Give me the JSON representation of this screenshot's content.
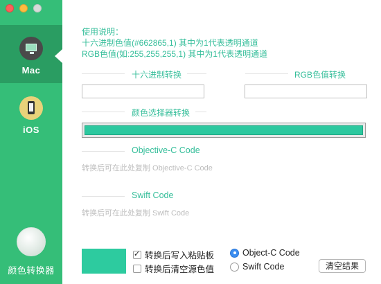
{
  "sidebar": {
    "items": [
      {
        "label": "Mac",
        "icon": "monitor-icon",
        "active": true
      },
      {
        "label": "iOS",
        "icon": "phone-icon",
        "active": false
      },
      {
        "label": "颜色转换器",
        "icon": "color-converter-icon",
        "active": false
      }
    ]
  },
  "help": {
    "title": "使用说明：",
    "line1": "十六进制色值(#662865,1) 其中为1代表透明通道",
    "line2": "RGB色值(如:255,255,255,1)  其中为1代表透明通道"
  },
  "sections": {
    "hex": "十六进制转换",
    "rgb": "RGB色值转换",
    "picker": "颜色选择器转换",
    "objc": "Objective-C Code",
    "swift": "Swift Code"
  },
  "inputs": {
    "hex_value": "",
    "rgb_value": ""
  },
  "hints": {
    "objc": "转换后可在此处复制  Objective-C Code",
    "swift": "转换后可在此处复制  Swift Code"
  },
  "options": {
    "write_clipboard": {
      "label": "转换后写入粘贴板",
      "checked": true
    },
    "clear_source": {
      "label": "转换后清空源色值",
      "checked": false
    },
    "objc_radio": {
      "label": "Object-C Code",
      "selected": true
    },
    "swift_radio": {
      "label": "Swift Code",
      "selected": false
    }
  },
  "clear_button": "清空结果",
  "colors": {
    "sidebar": "#35be78",
    "accent": "#35be9a",
    "picked_color": "#2dc89f"
  }
}
